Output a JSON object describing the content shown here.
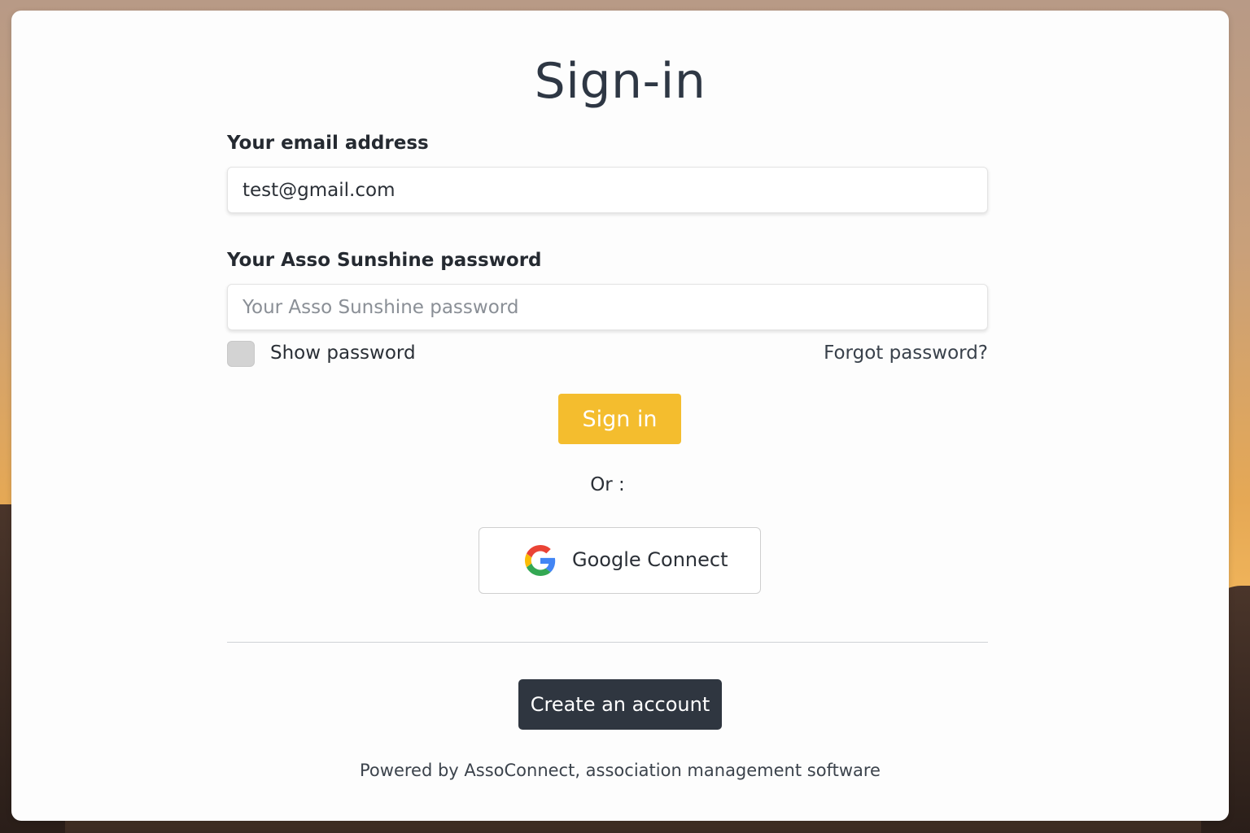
{
  "page": {
    "title": "Sign-in"
  },
  "email": {
    "label": "Your email address",
    "value": "test@gmail.com"
  },
  "password": {
    "label": "Your Asso Sunshine password",
    "placeholder": "Your Asso Sunshine password",
    "value": ""
  },
  "options": {
    "show_password_label": "Show password",
    "show_password_checked": false,
    "forgot_password_label": "Forgot password?"
  },
  "actions": {
    "sign_in_label": "Sign in",
    "or_label": "Or :",
    "google_label": "Google Connect",
    "create_account_label": "Create an account"
  },
  "footer": {
    "powered_by": "Powered by AssoConnect, association management software"
  },
  "colors": {
    "sign_in_button": "#f4bd2e",
    "create_account_button": "#2f3640",
    "title": "#2e3744"
  },
  "icons": {
    "google": "google-g-logo"
  }
}
